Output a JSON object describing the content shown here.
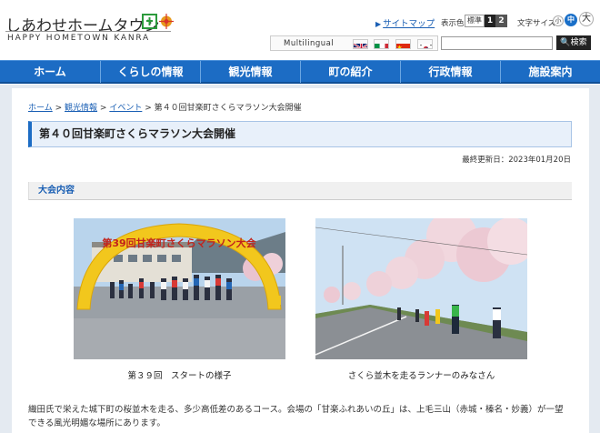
{
  "header": {
    "logo_main": "しあわせホームタウン",
    "logo_sub": "HAPPY HOMETOWN KANRA",
    "logo_mark_text": "甘楽",
    "sitemap": "サイトマップ",
    "contrast_label": "表示色",
    "contrast_standard": "標準",
    "contrast_1": "1",
    "contrast_2": "2",
    "font_size_label": "文字サイズ",
    "font_small": "小",
    "font_medium": "中",
    "font_large": "大",
    "multilingual": "Multilingual",
    "flags": [
      "english-flag",
      "italian-flag",
      "chinese-flag",
      "korean-flag"
    ],
    "search_placeholder": "",
    "search_button": "検索"
  },
  "nav": {
    "items": [
      {
        "label": "ホーム"
      },
      {
        "label": "くらしの情報"
      },
      {
        "label": "観光情報"
      },
      {
        "label": "町の紹介"
      },
      {
        "label": "行政情報"
      },
      {
        "label": "施設案内"
      }
    ]
  },
  "breadcrumb": {
    "home": "ホーム",
    "sep": ">",
    "tourism": "観光情報",
    "event": "イベント",
    "current": "第４０回甘楽町さくらマラソン大会開催"
  },
  "page": {
    "title": "第４０回甘楽町さくらマラソン大会開催",
    "updated": "最終更新日：2023年01月20日",
    "section_title": "大会内容",
    "arch_text": "第39回甘楽町さくらマラソン大会",
    "photo1_caption": "第３９回　スタートの様子",
    "photo2_caption": "さくら並木を走るランナーのみなさん",
    "description_1": "織田氏で栄えた城下町の桜並木を走る、多少高低差のあるコース。会場の「甘楽ふれあいの丘」は、上毛三山（赤城・榛名・妙義）が一望",
    "description_2": "できる風光明媚な場所にあります。"
  },
  "colors": {
    "nav_blue": "#1c6cc4",
    "link_blue": "#1a5fb4",
    "title_bg": "#e8f0fa"
  }
}
